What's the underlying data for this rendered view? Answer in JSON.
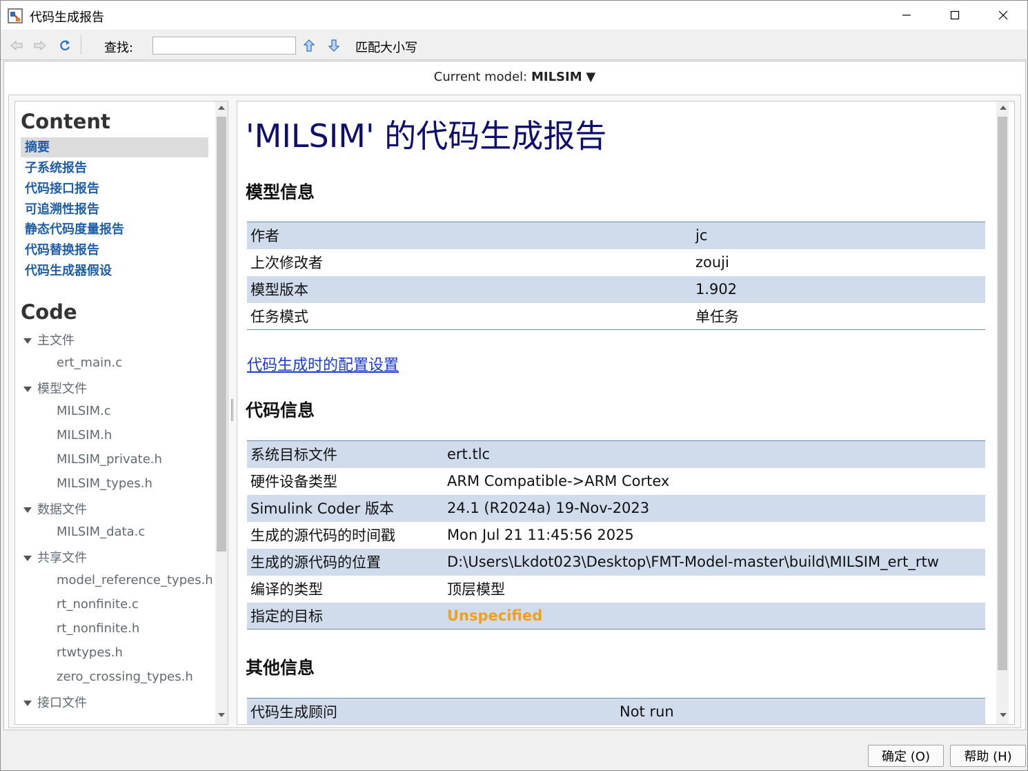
{
  "window": {
    "title": "代码生成报告",
    "minimize": "—",
    "maximize": "☐",
    "close": "✕"
  },
  "toolbar": {
    "find_label": "查找:",
    "find_value": "",
    "match_case_label": "匹配大小写"
  },
  "model_bar": {
    "prefix": "Current model:",
    "model_name": "MILSIM",
    "dropdown_arrow": "▼"
  },
  "sidebar": {
    "content_heading": "Content",
    "nav_items": [
      "摘要",
      "子系统报告",
      "代码接口报告",
      "可追溯性报告",
      "静态代码度量报告",
      "代码替换报告",
      "代码生成器假设"
    ],
    "selected_index": 0,
    "code_heading": "Code",
    "groups": [
      {
        "label": "主文件",
        "files": [
          "ert_main.c"
        ]
      },
      {
        "label": "模型文件",
        "files": [
          "MILSIM.c",
          "MILSIM.h",
          "MILSIM_private.h",
          "MILSIM_types.h"
        ]
      },
      {
        "label": "数据文件",
        "files": [
          "MILSIM_data.c"
        ]
      },
      {
        "label": "共享文件",
        "files": [
          "model_reference_types.h",
          "rt_nonfinite.c",
          "rt_nonfinite.h",
          "rtwtypes.h",
          "zero_crossing_types.h"
        ]
      },
      {
        "label": "接口文件",
        "files": []
      }
    ]
  },
  "report": {
    "title": "'MILSIM' 的代码生成报告",
    "model_info_heading": "模型信息",
    "model_info": [
      {
        "label": "作者",
        "value": "jc"
      },
      {
        "label": "上次修改者",
        "value": "zouji"
      },
      {
        "label": "模型版本",
        "value": "1.902"
      },
      {
        "label": "任务模式",
        "value": "单任务"
      }
    ],
    "config_link": "代码生成时的配置设置",
    "code_info_heading": "代码信息",
    "code_info": [
      {
        "label": "系统目标文件",
        "value": "ert.tlc"
      },
      {
        "label": "硬件设备类型",
        "value": "ARM Compatible->ARM Cortex"
      },
      {
        "label": "Simulink Coder 版本",
        "value": "24.1 (R2024a) 19-Nov-2023"
      },
      {
        "label": "生成的源代码的时间戳",
        "value": "Mon Jul 21 11:45:56 2025"
      },
      {
        "label": "生成的源代码的位置",
        "value": "D:\\Users\\Lkdot023\\Desktop\\FMT-Model-master\\build\\MILSIM_ert_rtw"
      },
      {
        "label": "编译的类型",
        "value": "顶层模型"
      },
      {
        "label": "指定的目标",
        "value": "Unspecified"
      }
    ],
    "other_info_heading": "其他信息",
    "other_info": [
      {
        "label": "代码生成顾问",
        "value": "Not run"
      }
    ]
  },
  "buttons": {
    "ok": "确定 (O)",
    "help": "帮助 (H)"
  },
  "colors": {
    "title_blue": "#0e0e6e",
    "nav_blue": "#1f5fa8",
    "row_alt": "#d0dcec",
    "unspecified_orange": "#f0a020",
    "link_blue": "#1a3ad0"
  }
}
